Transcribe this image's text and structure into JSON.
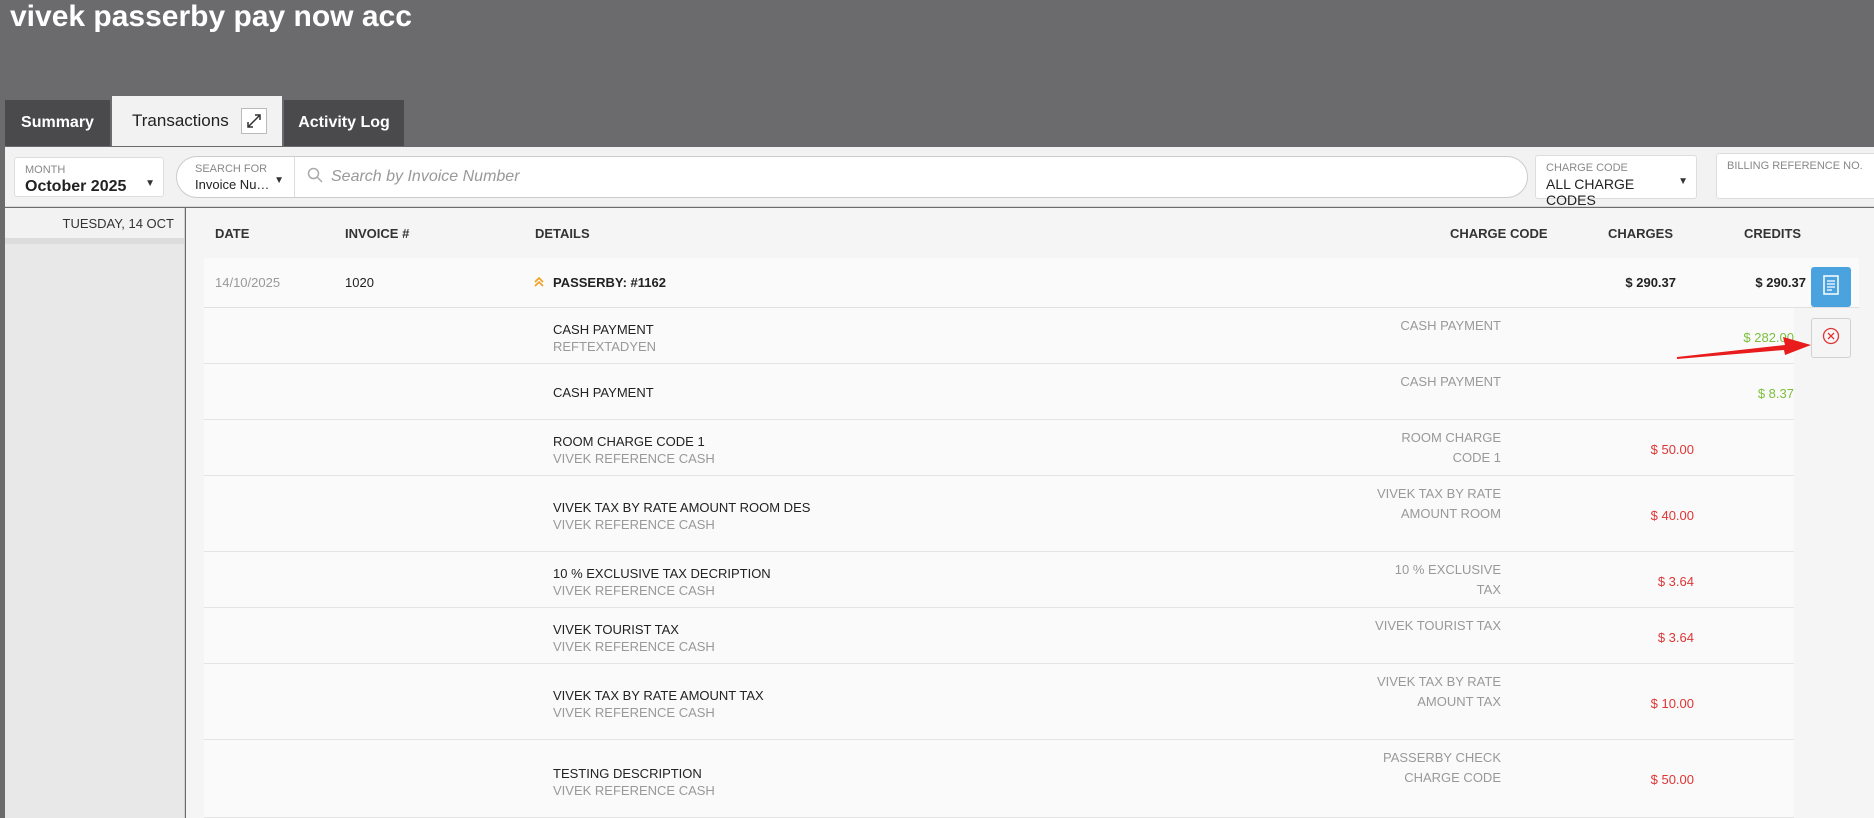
{
  "page": {
    "title": "vivek passerby pay now acc"
  },
  "tabs": {
    "summary": "Summary",
    "transactions": "Transactions",
    "activity_log": "Activity Log"
  },
  "toolbar": {
    "month_label": "MONTH",
    "month_value": "October 2025",
    "search_for_label": "SEARCH FOR",
    "search_for_value": "Invoice Nu…",
    "search_placeholder": "Search by Invoice Number",
    "charge_code_label": "CHARGE CODE",
    "charge_code_value": "ALL CHARGE CODES",
    "billing_ref_label": "BILLING REFERENCE NO."
  },
  "sidebar": {
    "date": "TUESDAY, 14 OCT"
  },
  "columns": {
    "date": "DATE",
    "invoice": "INVOICE #",
    "details": "DETAILS",
    "charge_code": "CHARGE CODE",
    "charges": "CHARGES",
    "credits": "CREDITS"
  },
  "invoice_row": {
    "date": "14/10/2025",
    "invoice": "1020",
    "details": "PASSERBY: #1162",
    "charges": "$ 290.37",
    "credits": "$ 290.37"
  },
  "details": [
    {
      "desc": "CASH PAYMENT",
      "ref": "REFTEXTADYEN",
      "code": "CASH PAYMENT",
      "charge": "",
      "credit": "$ 282.00"
    },
    {
      "desc": "CASH PAYMENT",
      "ref": "",
      "code": "CASH PAYMENT",
      "charge": "",
      "credit": "$ 8.37"
    },
    {
      "desc": "ROOM CHARGE CODE 1",
      "ref": "VIVEK REFERENCE CASH",
      "code": "ROOM CHARGE CODE 1",
      "charge": "$ 50.00",
      "credit": ""
    },
    {
      "desc": "VIVEK TAX BY RATE AMOUNT ROOM DES",
      "ref": "VIVEK REFERENCE CASH",
      "code": "VIVEK TAX BY RATE AMOUNT ROOM",
      "charge": "$ 40.00",
      "credit": ""
    },
    {
      "desc": "10 % EXCLUSIVE TAX DECRIPTION",
      "ref": "VIVEK REFERENCE CASH",
      "code": "10 % EXCLUSIVE TAX",
      "charge": "$ 3.64",
      "credit": ""
    },
    {
      "desc": "VIVEK TOURIST TAX",
      "ref": "VIVEK REFERENCE CASH",
      "code": "VIVEK TOURIST TAX",
      "charge": "$ 3.64",
      "credit": ""
    },
    {
      "desc": "VIVEK TAX BY RATE AMOUNT TAX",
      "ref": "VIVEK REFERENCE CASH",
      "code": "VIVEK TAX BY RATE AMOUNT TAX",
      "charge": "$ 10.00",
      "credit": ""
    },
    {
      "desc": "TESTING DESCRIPTION",
      "ref": "VIVEK REFERENCE CASH",
      "code": "PASSERBY CHECK CHARGE CODE",
      "charge": "$ 50.00",
      "credit": ""
    }
  ],
  "icons": {
    "print": "receipt-icon",
    "void": "close-circle-icon",
    "arrow_color": "#e81c1c",
    "expand_color": "#f0a020"
  }
}
